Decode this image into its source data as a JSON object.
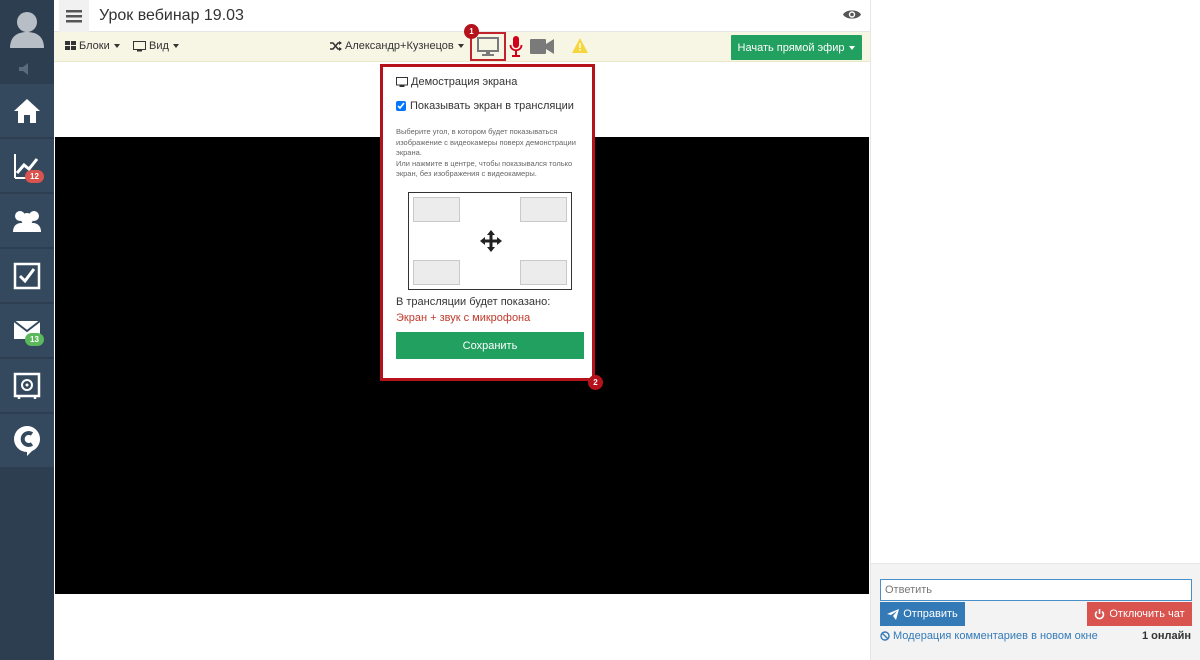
{
  "header": {
    "title": "Урок вебинар 19.03"
  },
  "sidebar": {
    "items": [
      {
        "icon": "home-icon"
      },
      {
        "icon": "chart-icon",
        "badge": "12"
      },
      {
        "icon": "users-icon"
      },
      {
        "icon": "checkbox-icon"
      },
      {
        "icon": "mail-icon",
        "badge": "13"
      },
      {
        "icon": "safe-icon"
      },
      {
        "icon": "c-logo-icon"
      }
    ]
  },
  "toolbar": {
    "blocks_label": "Блоки",
    "view_label": "Вид",
    "speakers_label": "Александр+Кузнецов",
    "live_label": "Начать прямой эфир"
  },
  "markers": {
    "one": "1",
    "two": "2"
  },
  "popup": {
    "title": "Демострация экрана",
    "show_screen_label": "Показывать экран в трансляции",
    "show_screen_checked": true,
    "description_1": "Выберите угол, в котором будет показываться изображение с видеокамеры поверх демонстрации экрана.",
    "description_2": "Или нажмите в центре, чтобы показывался только экран, без изображения с видеокамеры.",
    "result_label": "В трансляции будет показано:",
    "result_value": "Экран + звук с микрофона",
    "save_label": "Сохранить"
  },
  "chat": {
    "reply_placeholder": "Ответить",
    "send_label": "Отправить",
    "disable_label": "Отключить чат",
    "moderation_label": "Модерация комментариев в новом окне",
    "online_label": "1 онлайн"
  },
  "colors": {
    "accent_red": "#b5121b",
    "green": "#21a060",
    "sidebar": "#2d3e50"
  }
}
